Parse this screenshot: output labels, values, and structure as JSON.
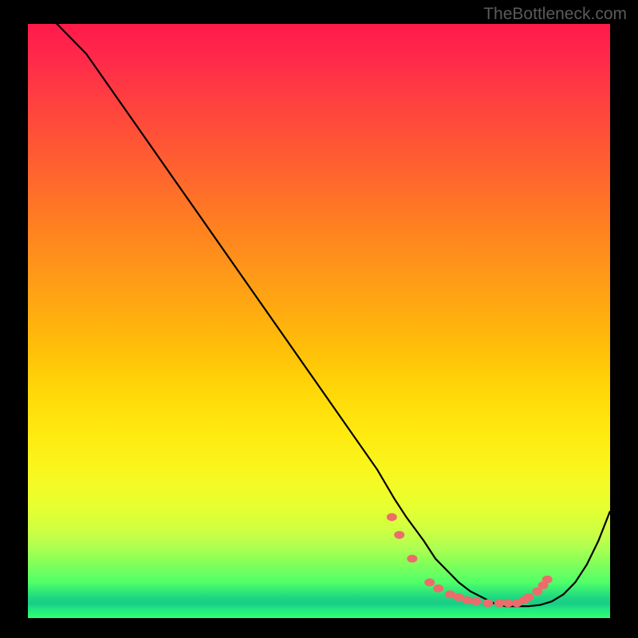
{
  "watermark": "TheBottleneck.com",
  "chart_data": {
    "type": "line",
    "title": "",
    "xlabel": "",
    "ylabel": "",
    "xlim": [
      0,
      100
    ],
    "ylim": [
      0,
      100
    ],
    "series": [
      {
        "name": "curve",
        "x": [
          0,
          5,
          10,
          15,
          20,
          25,
          30,
          35,
          40,
          45,
          50,
          55,
          60,
          63,
          65,
          68,
          70,
          72,
          74,
          76,
          78,
          80,
          82,
          84,
          86,
          88,
          90,
          92,
          94,
          96,
          98,
          100
        ],
        "y": [
          103,
          100,
          95,
          88,
          81,
          74,
          67,
          60,
          53,
          46,
          39,
          32,
          25,
          20,
          17,
          13,
          10,
          8,
          6,
          4.5,
          3.5,
          2.5,
          2,
          2,
          2,
          2.2,
          2.8,
          4,
          6,
          9,
          13,
          18
        ]
      }
    ],
    "markers": {
      "name": "points",
      "x": [
        62.5,
        63.8,
        66,
        69,
        70.5,
        72.5,
        74,
        75.5,
        77,
        79,
        81,
        82.5,
        84,
        85.2,
        86,
        87.5,
        88.5,
        89.2
      ],
      "y": [
        17,
        14,
        10,
        6,
        5,
        4,
        3.5,
        3,
        2.8,
        2.5,
        2.5,
        2.5,
        2.5,
        3,
        3.5,
        4.5,
        5.5,
        6.5
      ]
    },
    "colors": {
      "curve": "#000000",
      "markers": "#ed6b6b"
    }
  }
}
